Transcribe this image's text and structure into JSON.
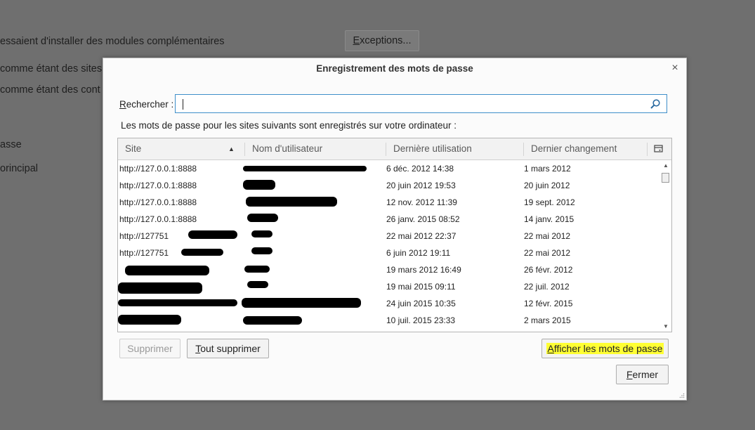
{
  "background": {
    "lines": [
      "essaient d'installer des modules complémentaires",
      " comme étant des sites",
      " comme étant des cont",
      "asse",
      "orincipal"
    ],
    "exceptions_button": {
      "mnemonic": "E",
      "rest": "xceptions..."
    }
  },
  "dialog": {
    "title": "Enregistrement des mots de passe",
    "close_glyph": "×",
    "search": {
      "label_mnemonic": "R",
      "label_rest": "echercher :",
      "value": ""
    },
    "info_text": "Les mots de passe pour les sites suivants sont enregistrés sur votre ordinateur :",
    "columns": [
      "Site",
      "Nom d'utilisateur",
      "Dernière utilisation",
      "Dernier changement"
    ],
    "rows": [
      {
        "site": "http://127.0.0.1:8888",
        "user": "",
        "last_used": "6 déc. 2012 14:38",
        "last_changed": "1 mars 2012"
      },
      {
        "site": "http://127.0.0.1:8888",
        "user": "",
        "last_used": "20 juin 2012 19:53",
        "last_changed": "20 juin 2012"
      },
      {
        "site": "http://127.0.0.1:8888",
        "user": "",
        "last_used": "12 nov. 2012 11:39",
        "last_changed": "19 sept. 2012"
      },
      {
        "site": "http://127.0.0.1:8888",
        "user": "",
        "last_used": "26 janv. 2015 08:52",
        "last_changed": "14 janv. 2015"
      },
      {
        "site": "http://127751",
        "user": "",
        "last_used": "22 mai 2012 22:37",
        "last_changed": "22 mai 2012"
      },
      {
        "site": "http://127751",
        "user": "",
        "last_used": "6 juin 2012 19:11",
        "last_changed": "22 mai 2012"
      },
      {
        "site": "",
        "user": "",
        "last_used": "19 mars 2012 16:49",
        "last_changed": "26 févr. 2012"
      },
      {
        "site": "",
        "user": "",
        "last_used": "19 mai 2015 09:11",
        "last_changed": "22 juil. 2012"
      },
      {
        "site": "",
        "user": "",
        "last_used": "24 juin 2015 10:35",
        "last_changed": "12 févr. 2015"
      },
      {
        "site": "",
        "user": "",
        "last_used": "10 juil. 2015 23:33",
        "last_changed": "2 mars 2015"
      }
    ],
    "buttons": {
      "delete": {
        "mnemonic": "",
        "text": "Supprimer"
      },
      "delete_all": {
        "mnemonic": "T",
        "rest": "out supprimer"
      },
      "show_passwords": {
        "mnemonic": "A",
        "rest": "fficher les mots de passe"
      },
      "close": {
        "mnemonic": "F",
        "rest": "ermer"
      }
    },
    "highlight_color": "#ffff33",
    "focus_color": "#3f8fc9"
  }
}
